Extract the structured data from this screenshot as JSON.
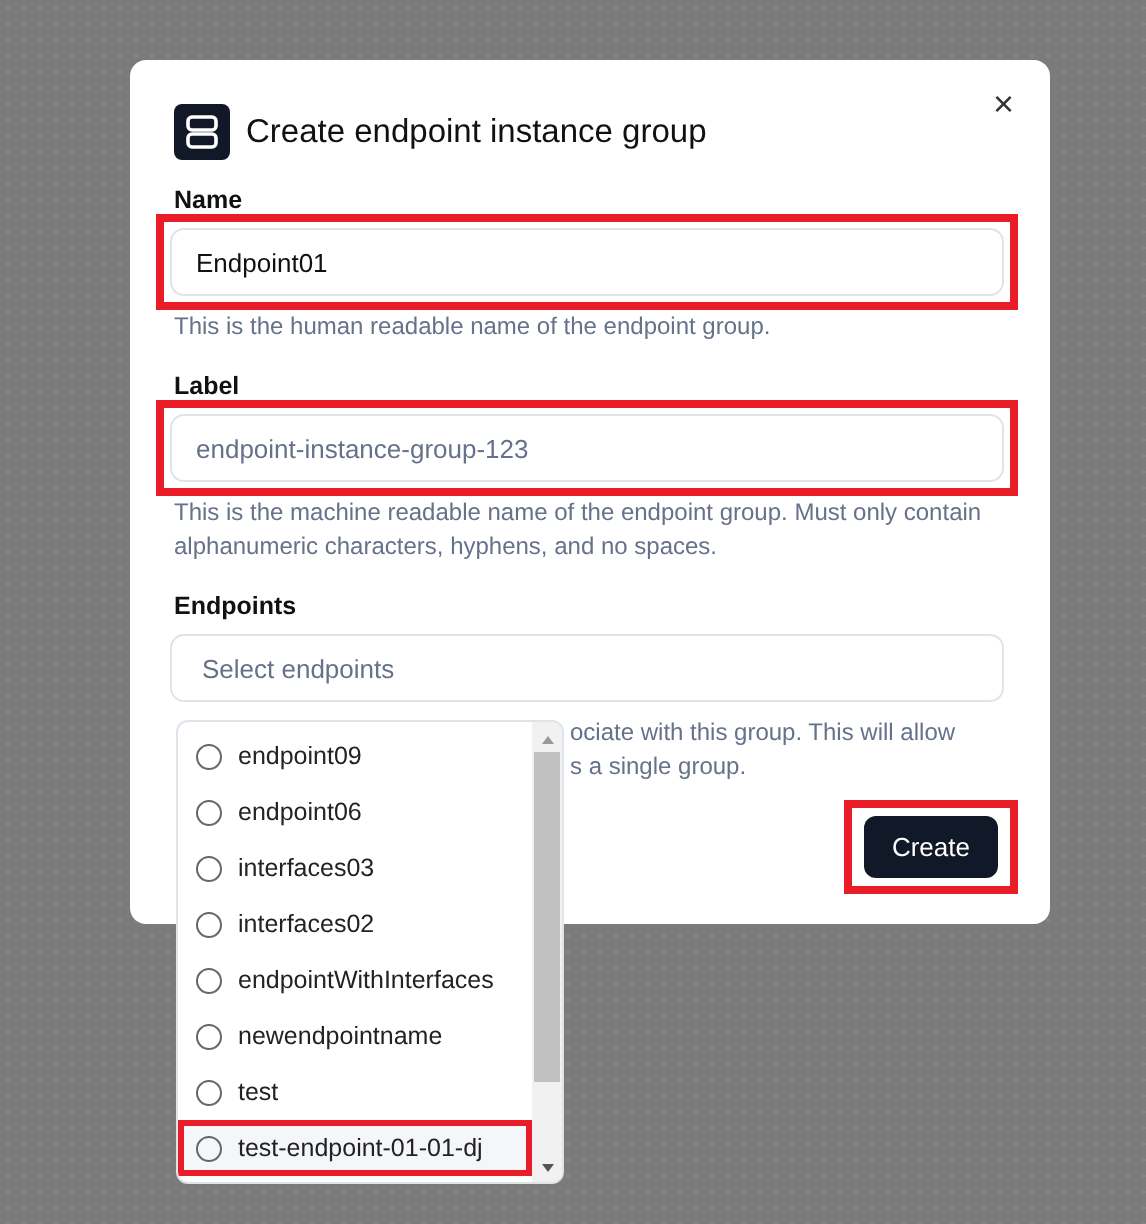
{
  "dialog": {
    "title": "Create endpoint instance group",
    "close": "×",
    "fields": [
      {
        "kind": "text",
        "label": "Name",
        "value": "Endpoint01",
        "hint": [
          "This is the human readable name of the endpoint group."
        ],
        "highlighted": true
      },
      {
        "kind": "text",
        "label": "Label",
        "placeholder": "endpoint-instance-group-123",
        "hint": [
          "This is the machine readable name of the endpoint group. Must only contain alphanumeric characters, hyphens, and no spaces."
        ],
        "highlighted": true
      },
      {
        "kind": "select",
        "label": "Endpoints",
        "placeholder": "Select endpoints",
        "hint": [
          "ociate with this group. This will allow",
          "s a single group."
        ],
        "highlighted": false,
        "expanded": true,
        "options": [
          {
            "label": "endpoint09",
            "checked": false,
            "highlighted": false
          },
          {
            "label": "endpoint06",
            "checked": false,
            "highlighted": false
          },
          {
            "label": "interfaces03",
            "checked": false,
            "highlighted": false
          },
          {
            "label": "interfaces02",
            "checked": false,
            "highlighted": false
          },
          {
            "label": "endpointWithInterfaces",
            "checked": false,
            "highlighted": false
          },
          {
            "label": "newendpointname",
            "checked": false,
            "highlighted": false
          },
          {
            "label": "test",
            "checked": false,
            "highlighted": false
          },
          {
            "label": "test-endpoint-01-01-dj",
            "checked": false,
            "highlighted": true
          }
        ]
      }
    ],
    "submit": {
      "label": "Create",
      "highlighted": true
    }
  }
}
